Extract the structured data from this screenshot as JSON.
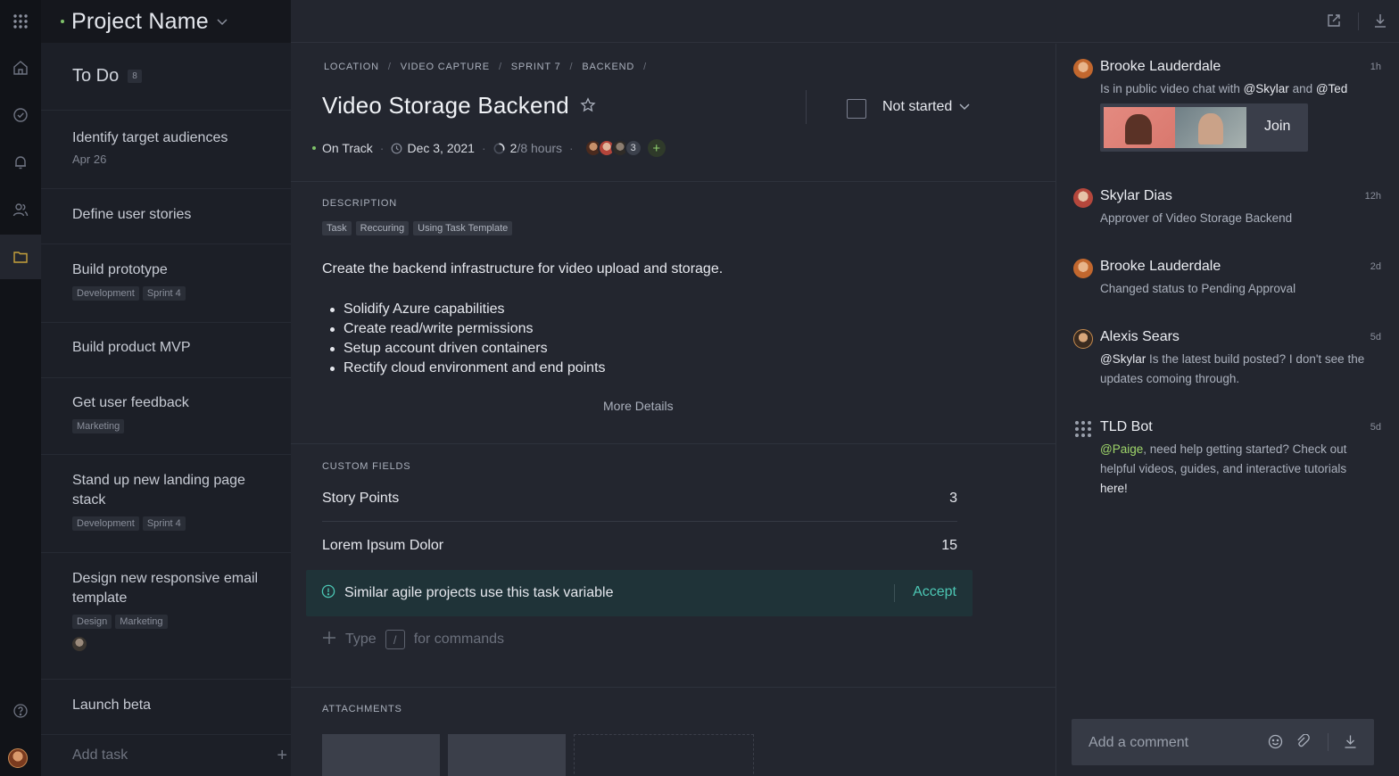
{
  "project": {
    "name": "Project Name"
  },
  "column": {
    "title": "To Do",
    "count": "8",
    "tasks": [
      {
        "title": "Identify target audiences",
        "sub": "Apr 26"
      },
      {
        "title": "Define user stories"
      },
      {
        "title": "Build prototype",
        "tags": [
          "Development",
          "Sprint 4"
        ]
      },
      {
        "title": "Build product MVP"
      },
      {
        "title": "Get user feedback",
        "tags": [
          "Marketing"
        ]
      },
      {
        "title": "Stand up new landing page stack",
        "tags": [
          "Development",
          "Sprint 4"
        ]
      },
      {
        "title": "Design new responsive email template",
        "tags": [
          "Design",
          "Marketing"
        ]
      },
      {
        "title": "Launch beta"
      }
    ],
    "add_task": "Add task"
  },
  "breadcrumbs": [
    "LOCATION",
    "VIDEO CAPTURE",
    "SPRINT 7",
    "BACKEND"
  ],
  "task": {
    "title": "Video Storage Backend",
    "status": "Not started",
    "health": "On Track",
    "due": "Dec 3, 2021",
    "hours_done": "2",
    "hours_total": "/8 hours",
    "assignee_extra": "3"
  },
  "description": {
    "label": "DESCRIPTION",
    "tags": [
      "Task",
      "Reccuring",
      "Using Task Template"
    ],
    "text": "Create the backend infrastructure for video upload and storage.",
    "bullets": [
      "Solidify Azure capabilities",
      "Create read/write permissions",
      "Setup account driven containers",
      "Rectify cloud environment and end points"
    ],
    "more": "More Details"
  },
  "custom_fields": {
    "label": "CUSTOM FIELDS",
    "rows": [
      {
        "name": "Story Points",
        "value": "3"
      },
      {
        "name": "Lorem Ipsum Dolor",
        "value": "15"
      }
    ],
    "suggestion": "Similar agile projects use this task variable",
    "accept": "Accept",
    "cmd_type": "Type",
    "cmd_slash": "/",
    "cmd_rest": "for commands"
  },
  "attachments": {
    "label": "ATTACHMENTS"
  },
  "activity": [
    {
      "name": "Brooke Lauderdale",
      "time": "1h",
      "pre": "Is in public video chat with ",
      "m1": "@Skylar",
      "mid": " and ",
      "m2": "@Ted",
      "join": "Join"
    },
    {
      "name": "Skylar Dias",
      "time": "12h",
      "msg": "Approver of Video Storage Backend"
    },
    {
      "name": "Brooke Lauderdale",
      "time": "2d",
      "msg": "Changed status to Pending Approval"
    },
    {
      "name": "Alexis Sears",
      "time": "5d",
      "mention": "@Skylar",
      "msg": " Is the latest build posted? I don't see the updates comoing through."
    },
    {
      "name": "TLD Bot",
      "time": "5d",
      "mention": "@Paige",
      "msg": ", need help getting started? Check out helpful videos, guides, and interactive tutorials ",
      "link": "here!"
    }
  ],
  "comment": {
    "placeholder": "Add a comment"
  }
}
